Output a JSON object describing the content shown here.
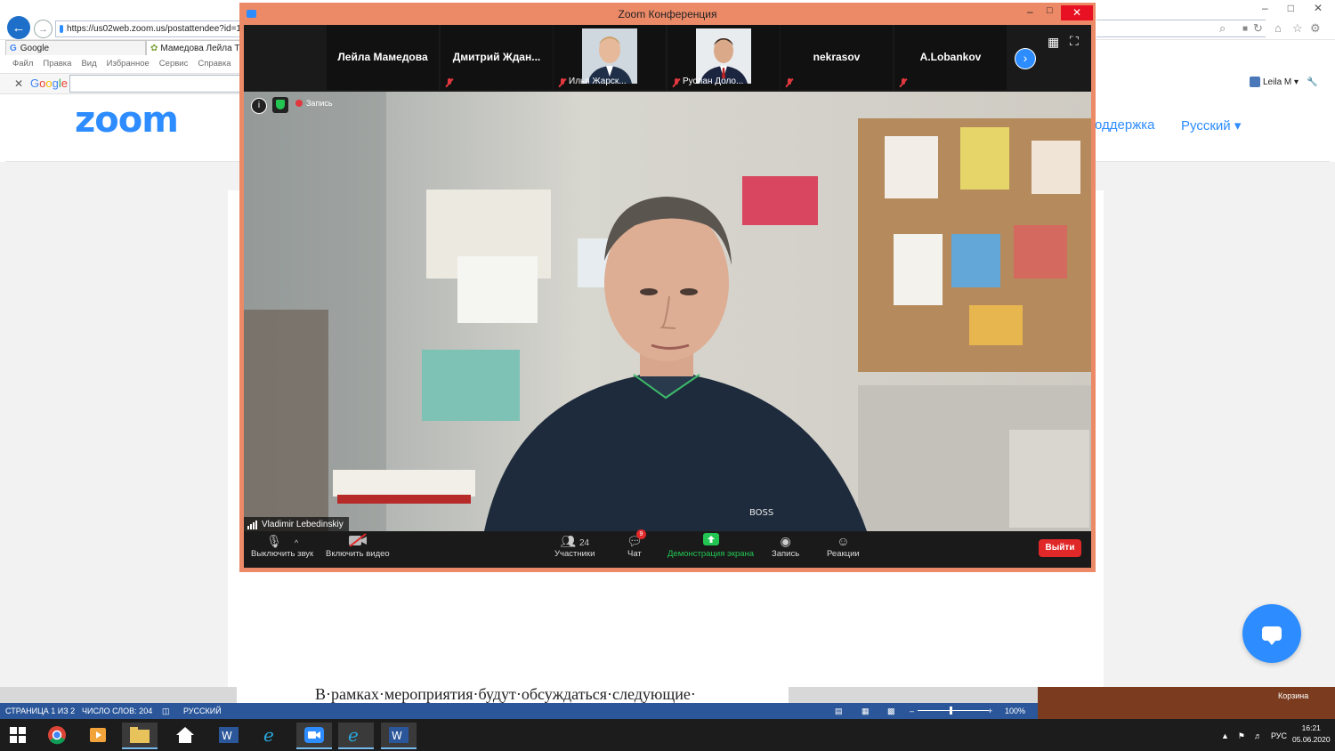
{
  "browser": {
    "url": "https://us02web.zoom.us/postattendee?id=1",
    "tabs": [
      "Google",
      "Мамедова Лейла То"
    ],
    "menu": [
      "Файл",
      "Правка",
      "Вид",
      "Избранное",
      "Сервис",
      "Справка"
    ],
    "google_toolbar_label": "Google",
    "user_label": "Leila M ▾"
  },
  "site": {
    "logo": "zoom",
    "support_link": "оддержка",
    "language": "Русский ▾"
  },
  "zoom_window": {
    "title": "Zoom Конференция",
    "participants_strip": [
      {
        "name": "Лейла Мамедова",
        "has_video": false
      },
      {
        "name": "Дмитрий  Ждан...",
        "has_video": false
      },
      {
        "name": "Илья Жарск...",
        "has_video": true
      },
      {
        "name": "Руслан Доло...",
        "has_video": true
      },
      {
        "name": "nekrasov",
        "has_video": false
      },
      {
        "name": "A.Lobankov",
        "has_video": false
      }
    ],
    "recording_label": "Запись",
    "active_speaker": "Vladimir Lebedinskiy",
    "toolbar": {
      "mute": "Выключить звук",
      "video": "Включить видео",
      "participants": "Участники",
      "participants_count": "24",
      "chat": "Чат",
      "chat_badge": "9",
      "share": "Демонстрация экрана",
      "record": "Запись",
      "reactions": "Реакции",
      "leave": "Выйти"
    },
    "colors": {
      "accent": "#2d8cff",
      "share_green": "#23c552",
      "leave_red": "#e02828",
      "window_border": "#ec8a68"
    }
  },
  "word": {
    "doc_line": "В·рамках·мероприятия·будут·обсуждаться·следующие·",
    "status": {
      "page": "СТРАНИЦА 1 ИЗ 2",
      "words": "ЧИСЛО СЛОВ: 204",
      "language": "РУССКИЙ",
      "zoom": "100%"
    }
  },
  "desktop": {
    "recycle_bin": "Корзина",
    "tray_lang": "РУС",
    "time": "16:21",
    "date": "05.06.2020"
  }
}
